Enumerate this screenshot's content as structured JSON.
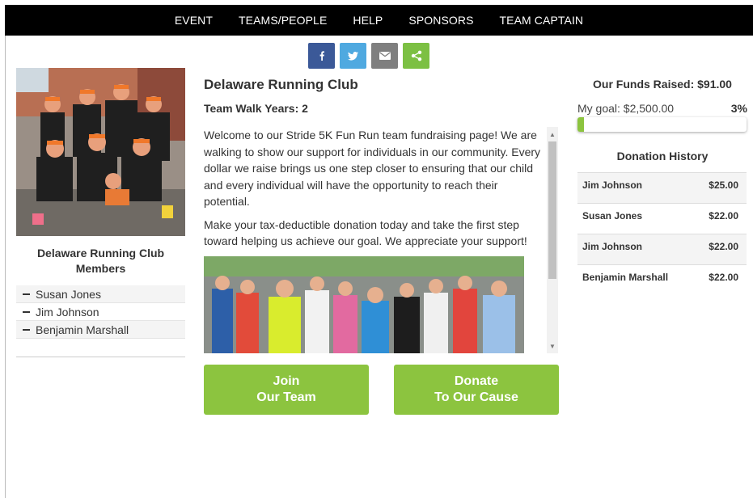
{
  "nav": {
    "items": [
      "EVENT",
      "TEAMS/PEOPLE",
      "HELP",
      "SPONSORS",
      "TEAM CAPTAIN"
    ]
  },
  "share": {
    "icons": [
      "facebook-icon",
      "twitter-icon",
      "email-icon",
      "share-icon"
    ],
    "colors": {
      "facebook": "#3b5998",
      "twitter": "#4fa9e0",
      "email": "#7f7f7f",
      "share": "#7cc043"
    }
  },
  "team": {
    "name": "Delaware Running Club",
    "walk_years": "Team Walk Years: 2",
    "members_title": "Delaware Running Club Members",
    "members": [
      "Susan Jones",
      "Jim Johnson",
      "Benjamin Marshall"
    ]
  },
  "story": {
    "p1": "Welcome to our Stride 5K Fun Run team fundraising page!  We are walking to show our support for individuals in our community. Every dollar we raise brings us one step closer to ensuring that our child and every individual will have the opportunity to reach their potential.",
    "p2": "Make your tax-deductible donation today and take the first step toward helping us achieve our goal. We appreciate your support!"
  },
  "buttons": {
    "join_line1": "Join",
    "join_line2": "Our Team",
    "donate_line1": "Donate",
    "donate_line2": "To Our Cause"
  },
  "fundraising": {
    "raised": "Our Funds Raised: $91.00",
    "goal": "My goal: $2,500.00",
    "percent": "3%",
    "progress_fraction": 0.036,
    "accent_color": "#8cc43f"
  },
  "donation_history": {
    "title": "Donation History",
    "rows": [
      {
        "name": "Jim Johnson",
        "amount": "$25.00"
      },
      {
        "name": "Susan Jones",
        "amount": "$22.00"
      },
      {
        "name": "Jim Johnson",
        "amount": "$22.00"
      },
      {
        "name": "Benjamin Marshall",
        "amount": "$22.00"
      }
    ]
  }
}
